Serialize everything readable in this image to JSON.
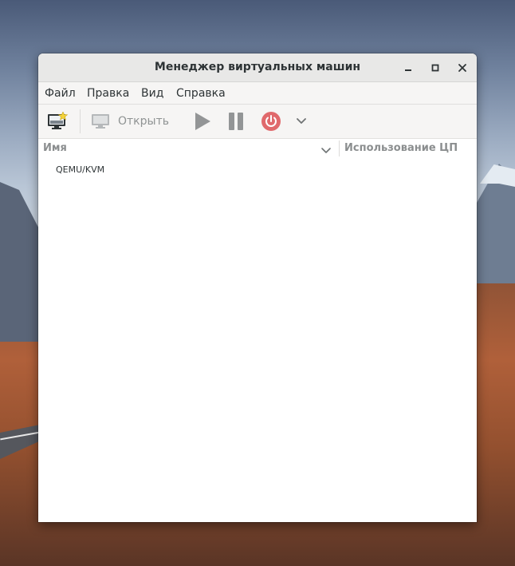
{
  "window": {
    "title": "Менеджер виртуальных машин",
    "controls": {
      "minimize_icon": "window-minimize-icon",
      "maximize_icon": "window-maximize-icon",
      "close_icon": "window-close-icon"
    }
  },
  "menubar": {
    "items": [
      {
        "label": "Файл"
      },
      {
        "label": "Правка"
      },
      {
        "label": "Вид"
      },
      {
        "label": "Справка"
      }
    ]
  },
  "toolbar": {
    "new_vm_icon": "new-vm-monitor-star-icon",
    "open_icon": "monitor-icon",
    "open_label": "Открыть",
    "run_icon": "play-icon",
    "pause_icon": "pause-icon",
    "shutdown_icon": "power-icon",
    "more_icon": "chevron-down-icon",
    "colors": {
      "disabled": "#8f9393",
      "power": "#e0696c",
      "new_star": "#f4d33a"
    }
  },
  "columns": {
    "name": "Имя",
    "cpu": "Использование ЦП",
    "sort_icon": "chevron-down-icon"
  },
  "connections": [
    {
      "label": "QEMU/KVM"
    }
  ]
}
